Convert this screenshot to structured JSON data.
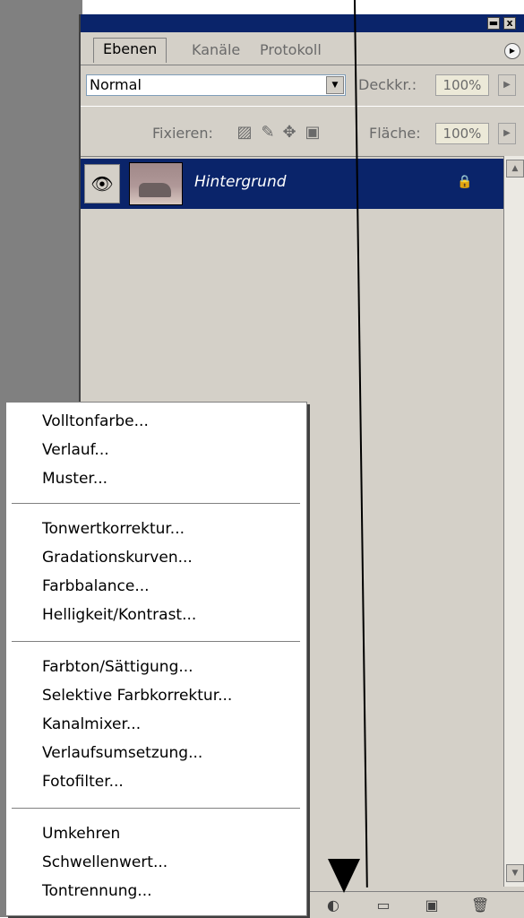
{
  "panel": {
    "tabs": [
      "Ebenen",
      "Kanäle",
      "Protokoll"
    ],
    "blend_mode": "Normal",
    "opacity_label": "Deckkr.:",
    "opacity_value": "100%",
    "lock_label": "Fixieren:",
    "fill_label": "Fläche:",
    "fill_value": "100%",
    "title_minimize": "▬",
    "title_close": "x",
    "tab_menu_icon": "▶"
  },
  "layer": {
    "name": "Hintergrund",
    "eye_icon": "👁",
    "lock_icon": "🔒"
  },
  "scroll": {
    "up": "▲",
    "down": "▼"
  },
  "bottom_icons": [
    "adjustment-layer-icon",
    "folder-icon",
    "new-layer-icon",
    "trash-icon"
  ],
  "bottom_glyphs": [
    "◐",
    "▭",
    "▣",
    "🗑"
  ],
  "menu": {
    "groups": [
      [
        "Volltonfarbe...",
        "Verlauf...",
        "Muster..."
      ],
      [
        "Tonwertkorrektur...",
        "Gradationskurven...",
        "Farbbalance...",
        "Helligkeit/Kontrast..."
      ],
      [
        "Farbton/Sättigung...",
        "Selektive Farbkorrektur...",
        "Kanalmixer...",
        "Verlaufsumsetzung...",
        "Fotofilter..."
      ],
      [
        "Umkehren",
        "Schwellenwert...",
        "Tontrennung..."
      ]
    ]
  }
}
